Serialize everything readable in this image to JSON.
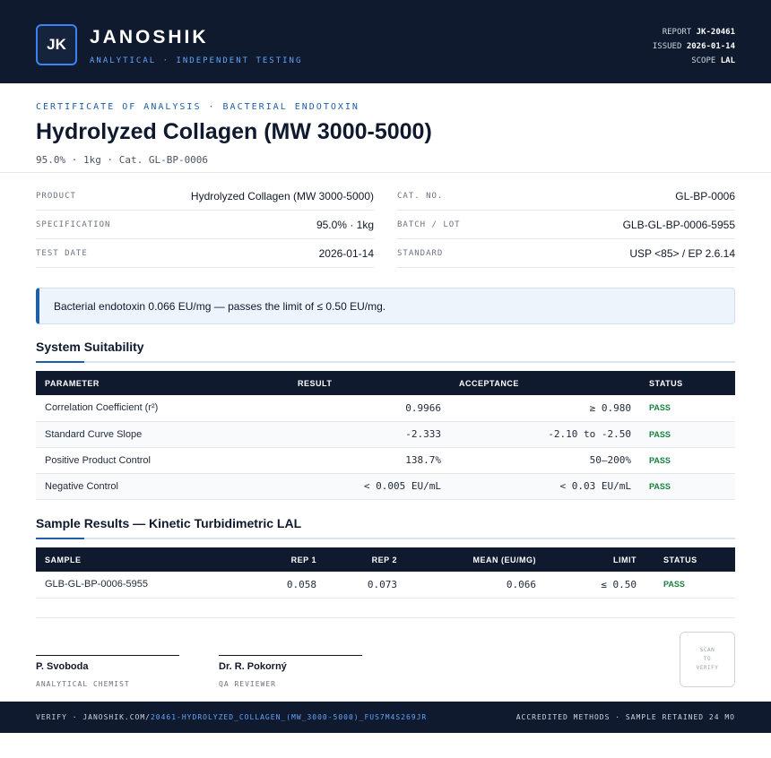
{
  "header": {
    "logo_text": "JK",
    "brand": "JANOSHIK",
    "tagline": "ANALYTICAL · INDEPENDENT TESTING",
    "report_label": "REPORT",
    "report_value": "JK-20461",
    "issued_label": "ISSUED",
    "issued_value": "2026-01-14",
    "scope_label": "SCOPE",
    "scope_value": "LAL"
  },
  "title_block": {
    "kicker": "CERTIFICATE OF ANALYSIS · BACTERIAL ENDOTOXIN",
    "title": "Hydrolyzed Collagen (MW 3000-5000)",
    "subtitle": "95.0% · 1kg  ·  Cat. GL-BP-0006"
  },
  "info": {
    "left": [
      {
        "label": "PRODUCT",
        "value": "Hydrolyzed Collagen (MW 3000-5000)"
      },
      {
        "label": "SPECIFICATION",
        "value": "95.0% · 1kg"
      },
      {
        "label": "TEST DATE",
        "value": "2026-01-14"
      }
    ],
    "right": [
      {
        "label": "CAT. NO.",
        "value": "GL-BP-0006"
      },
      {
        "label": "BATCH / LOT",
        "value": "GLB-GL-BP-0006-5955"
      },
      {
        "label": "STANDARD",
        "value": "USP <85> / EP 2.6.14"
      }
    ]
  },
  "callout": "Bacterial endotoxin 0.066 EU/mg — passes the limit of ≤ 0.50 EU/mg.",
  "suitability": {
    "title": "System Suitability",
    "headers": [
      "PARAMETER",
      "RESULT",
      "ACCEPTANCE",
      "STATUS"
    ],
    "rows": [
      {
        "parameter": "Correlation Coefficient (r²)",
        "result": "0.9966",
        "acceptance": "≥ 0.980",
        "status": "PASS"
      },
      {
        "parameter": "Standard Curve Slope",
        "result": "-2.333",
        "acceptance": "-2.10 to -2.50",
        "status": "PASS"
      },
      {
        "parameter": "Positive Product Control",
        "result": "138.7%",
        "acceptance": "50–200%",
        "status": "PASS"
      },
      {
        "parameter": "Negative Control",
        "result": "< 0.005 EU/mL",
        "acceptance": "< 0.03 EU/mL",
        "status": "PASS"
      }
    ]
  },
  "samples": {
    "title": "Sample Results — Kinetic Turbidimetric LAL",
    "headers": [
      "SAMPLE",
      "REP 1",
      "REP 2",
      "MEAN (EU/MG)",
      "LIMIT",
      "STATUS"
    ],
    "rows": [
      {
        "sample": "GLB-GL-BP-0006-5955",
        "rep1": "0.058",
        "rep2": "0.073",
        "mean": "0.066",
        "limit": "≤ 0.50",
        "status": "PASS"
      }
    ]
  },
  "signatures": [
    {
      "name": "P. Svoboda",
      "role": "ANALYTICAL CHEMIST"
    },
    {
      "name": "Dr. R. Pokorný",
      "role": "QA REVIEWER"
    }
  ],
  "qr_text": [
    "SCAN",
    "TO",
    "VERIFY"
  ],
  "footer": {
    "verify_prefix": "VERIFY · JANOSHIK.COM/",
    "verify_link": "20461-HYDROLYZED_COLLAGEN_(MW_3000-5000)_FUS7M4S269JR",
    "right": "ACCREDITED METHODS · SAMPLE RETAINED 24 MO"
  }
}
